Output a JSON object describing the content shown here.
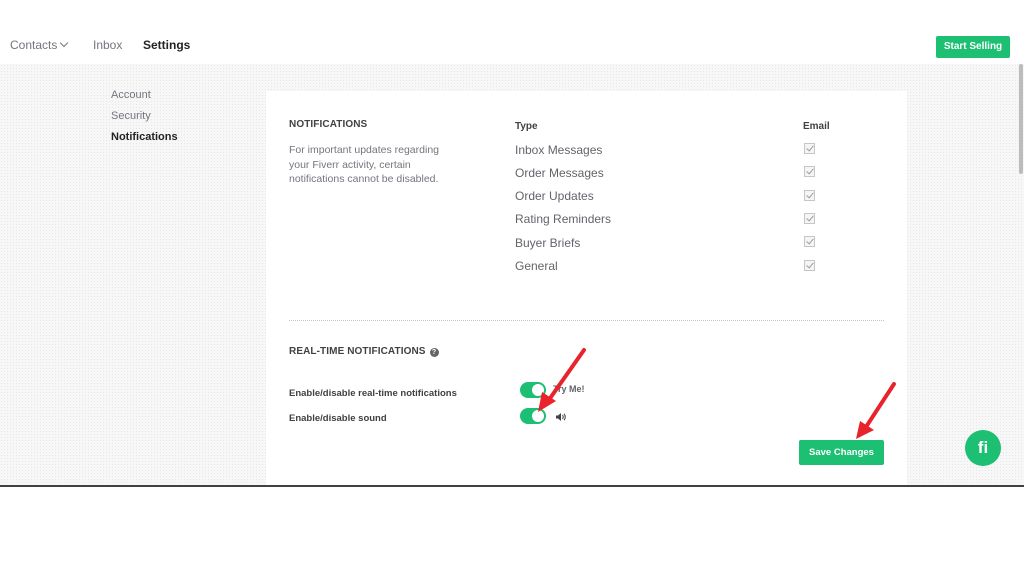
{
  "topnav": {
    "contacts_label": "Contacts",
    "inbox_label": "Inbox",
    "settings_label": "Settings",
    "start_selling_label": "Start Selling"
  },
  "sidebar": {
    "items": [
      {
        "label": "Account"
      },
      {
        "label": "Security"
      },
      {
        "label": "Notifications"
      }
    ]
  },
  "notifications": {
    "title": "NOTIFICATIONS",
    "description": "For important updates regarding your Fiverr activity, certain notifications cannot be disabled.",
    "type_header": "Type",
    "email_header": "Email",
    "rows": [
      {
        "label": "Inbox Messages",
        "email_checked": true
      },
      {
        "label": "Order Messages",
        "email_checked": true
      },
      {
        "label": "Order Updates",
        "email_checked": true
      },
      {
        "label": "Rating Reminders",
        "email_checked": true
      },
      {
        "label": "Buyer Briefs",
        "email_checked": true
      },
      {
        "label": "General",
        "email_checked": true
      }
    ]
  },
  "realtime": {
    "title": "REAL-TIME NOTIFICATIONS",
    "realtime_label": "Enable/disable real-time notifications",
    "sound_label": "Enable/disable sound",
    "try_me": "Try Me!",
    "realtime_on": true,
    "sound_on": true
  },
  "save_label": "Save Changes",
  "fab_label": "fi",
  "colors": {
    "accent": "#1dbf73",
    "annotation_arrow": "#e8232b"
  },
  "icons": [
    "chevron-down-icon",
    "help-icon",
    "speaker-icon",
    "fiverr-logo-icon",
    "annotation-arrow"
  ]
}
